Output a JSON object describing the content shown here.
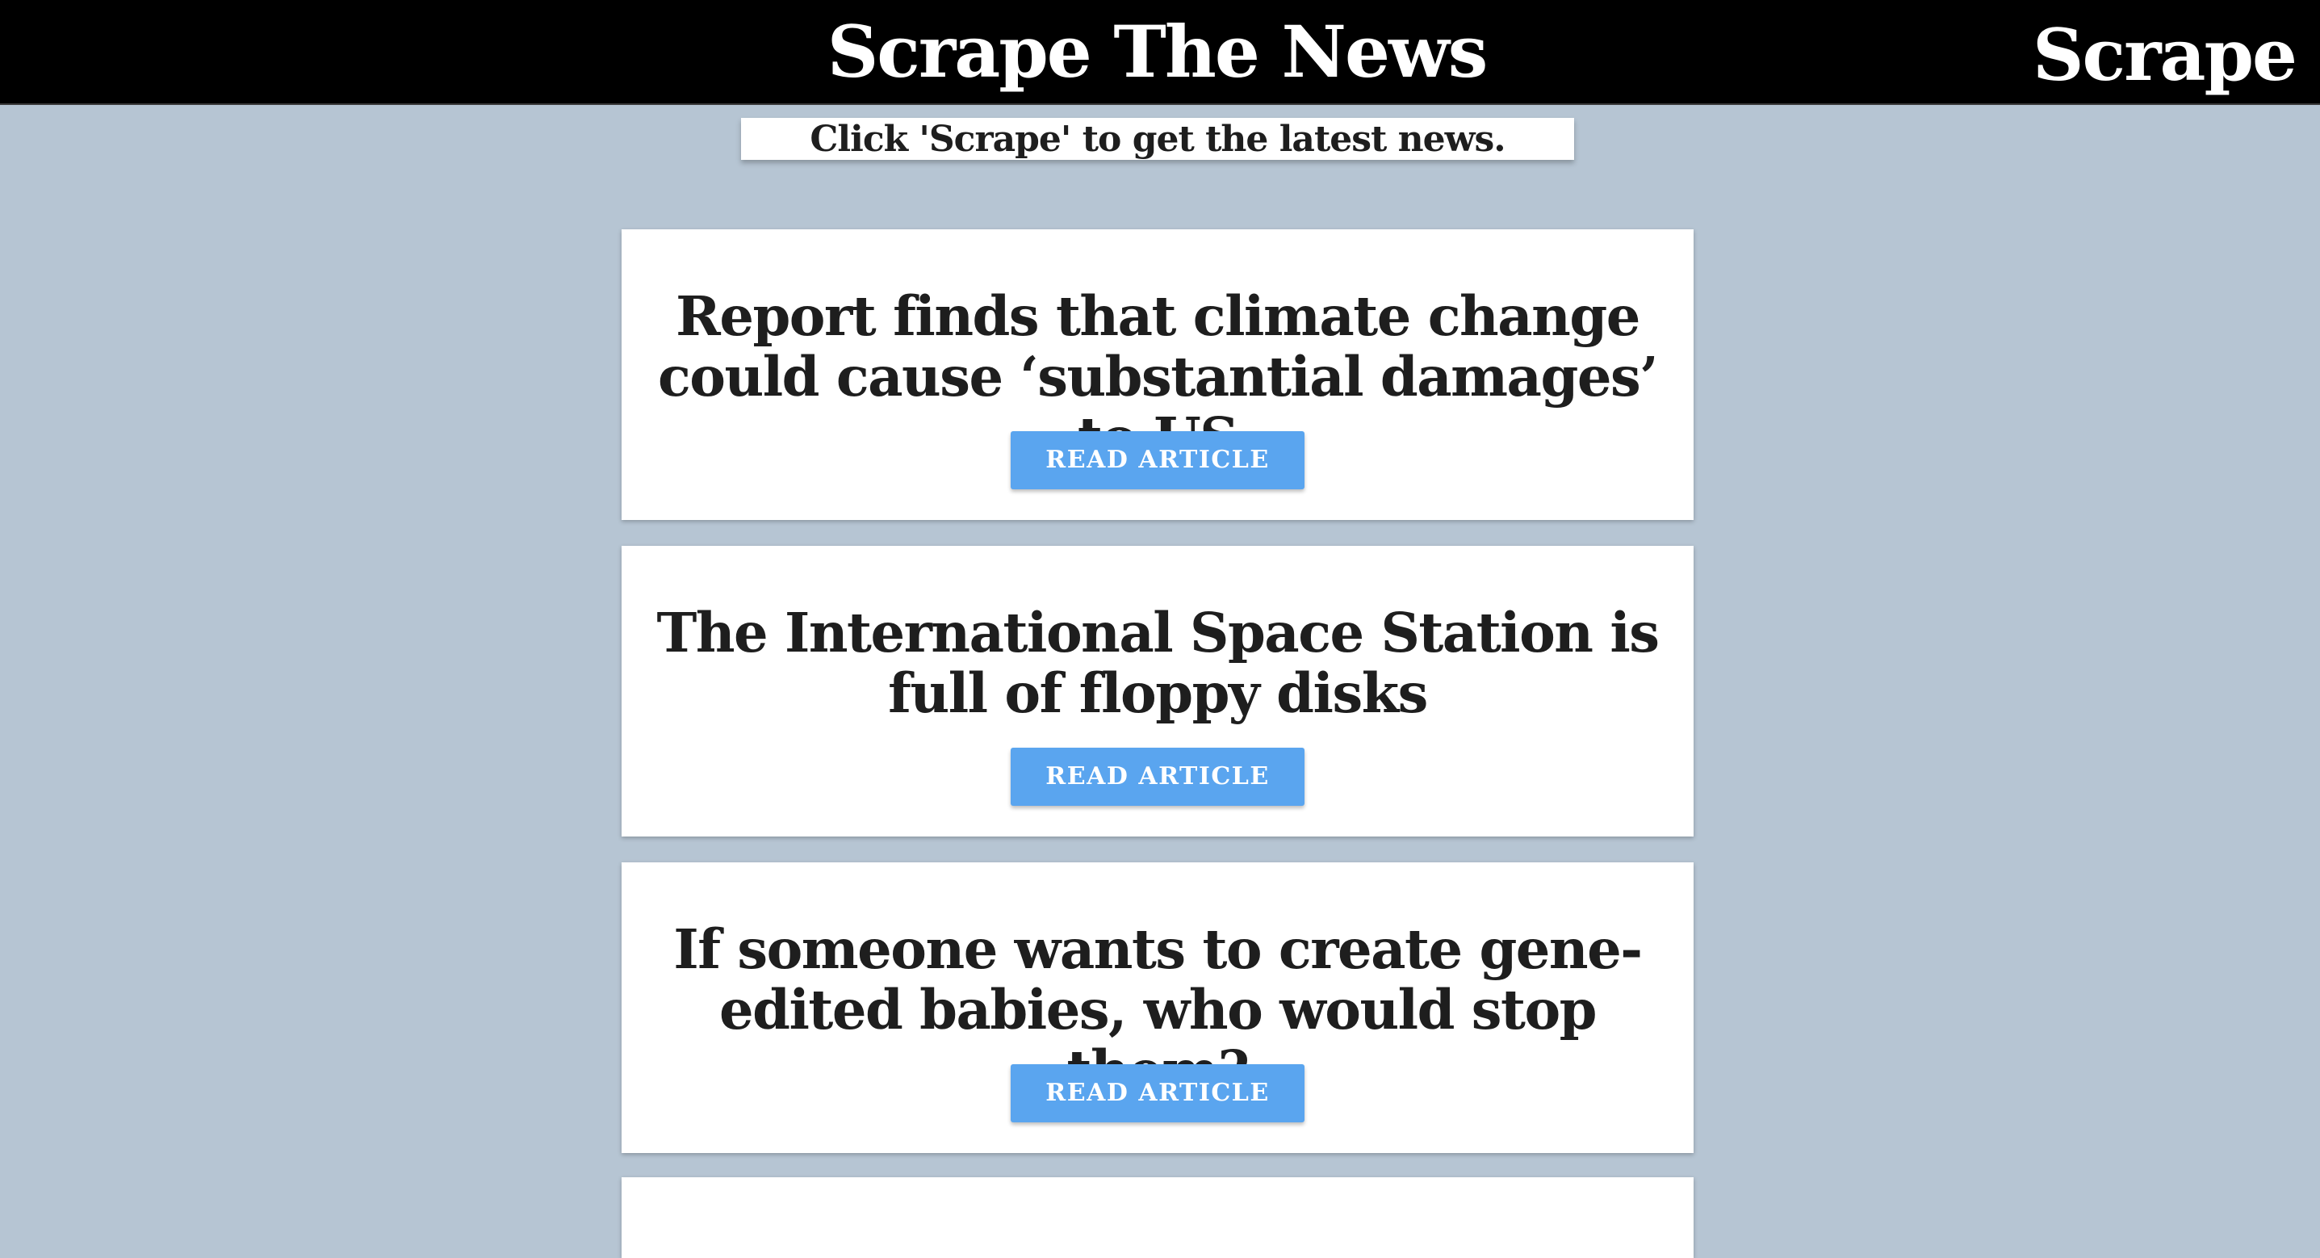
{
  "header": {
    "brand": "Scrape The News",
    "scrape_link": "Scrape"
  },
  "hint": {
    "text": "Click 'Scrape' to get the latest news."
  },
  "articles": [
    {
      "title": "Report finds that climate change could cause ‘substantial damages’ to US",
      "button_label": "READ ARTICLE"
    },
    {
      "title": "The International Space Station is full of floppy disks",
      "button_label": "READ ARTICLE"
    },
    {
      "title": "If someone wants to create gene-edited babies, who would stop them?",
      "button_label": "READ ARTICLE"
    }
  ],
  "colors": {
    "background": "#b6c5d3",
    "navbar": "#000000",
    "button": "#5aa5ef",
    "card": "#ffffff",
    "text": "#1e1e1e"
  }
}
